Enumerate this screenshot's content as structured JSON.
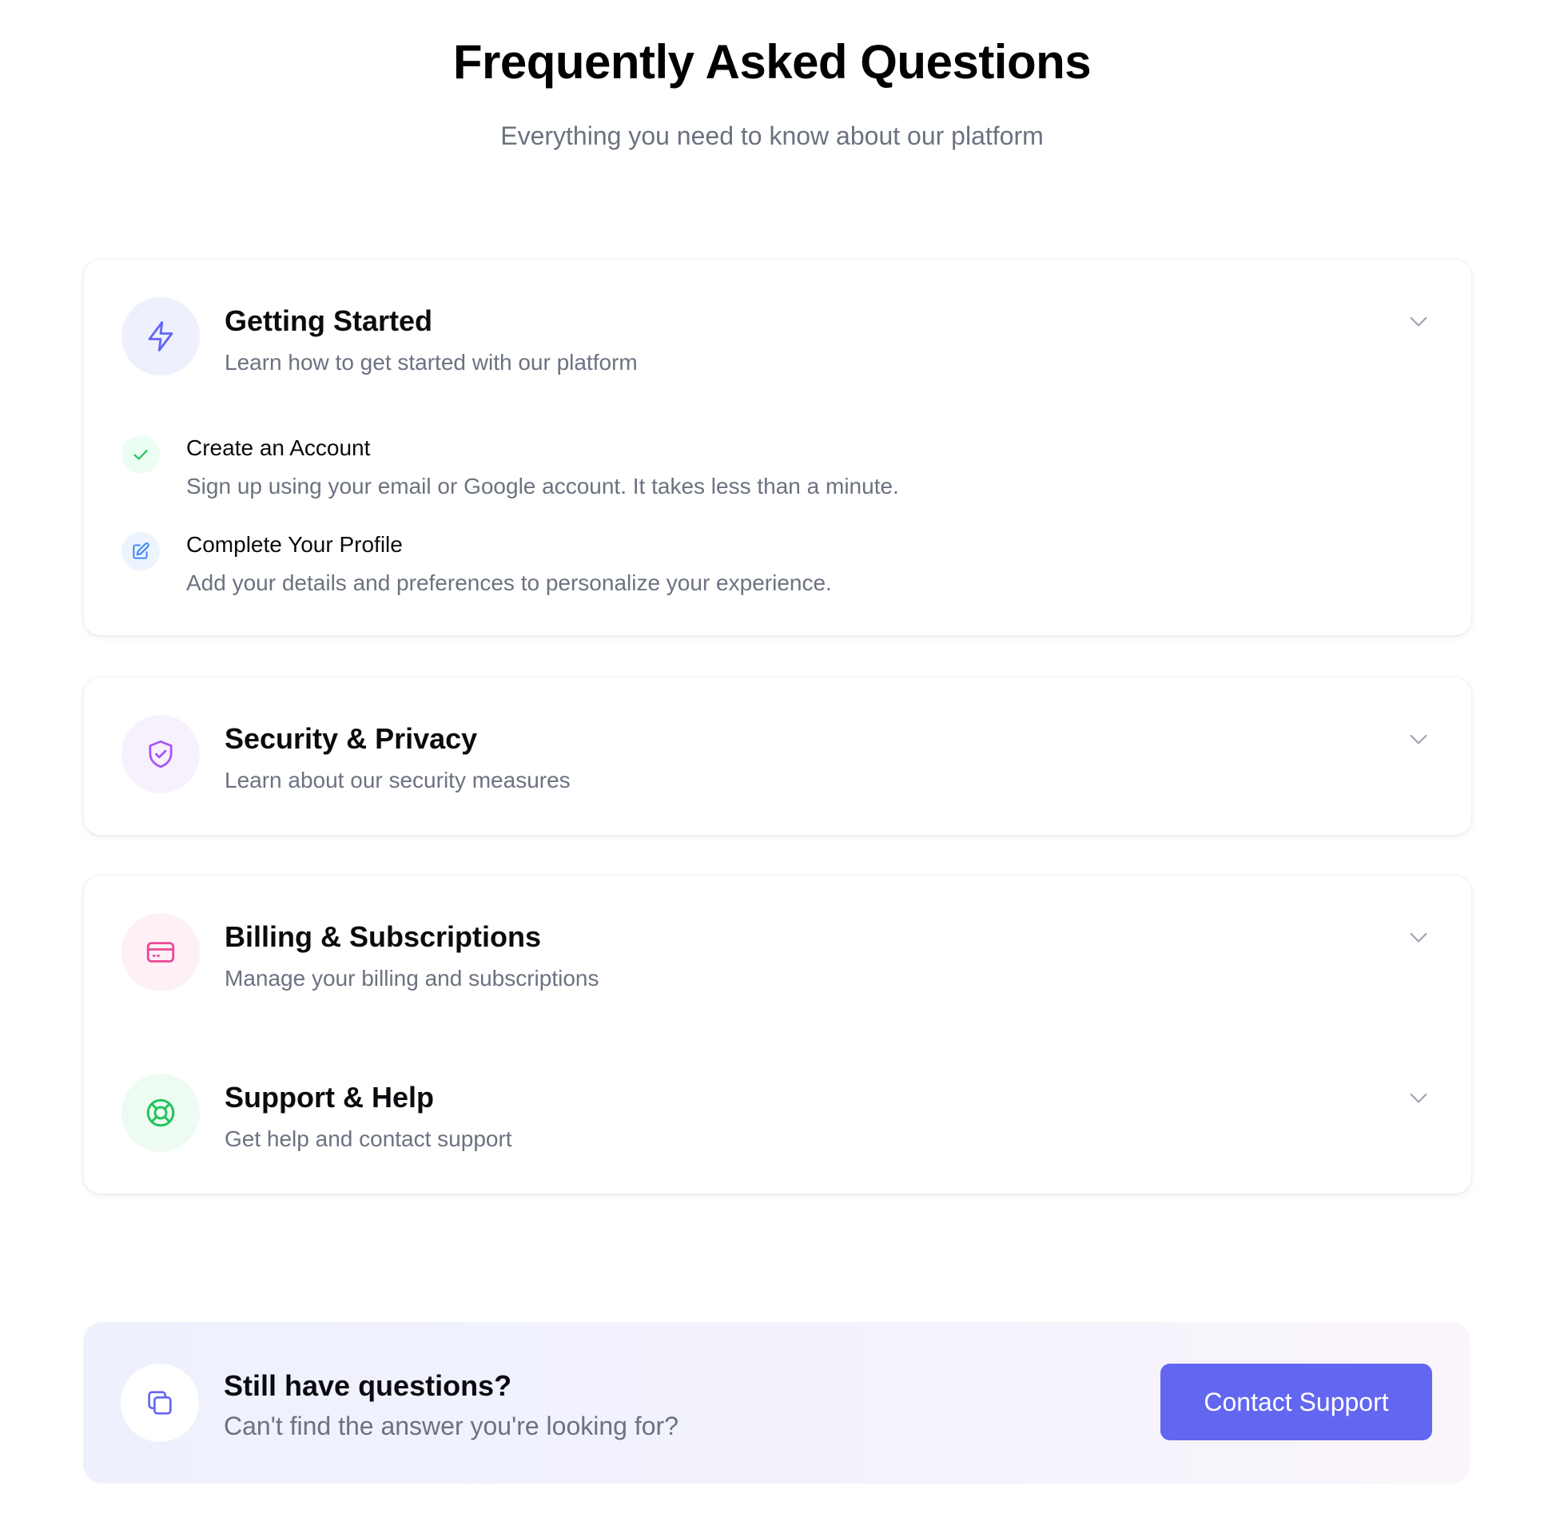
{
  "header": {
    "title": "Frequently Asked Questions",
    "subtitle": "Everything you need to know about our platform"
  },
  "sections": [
    {
      "title": "Getting Started",
      "description": "Learn how to get started with our platform",
      "icon": "lightning-icon",
      "expanded": true,
      "items": [
        {
          "icon": "check-icon",
          "title": "Create an Account",
          "description": "Sign up using your email or Google account. It takes less than a minute."
        },
        {
          "icon": "edit-icon",
          "title": "Complete Your Profile",
          "description": "Add your details and preferences to personalize your experience."
        }
      ]
    },
    {
      "title": "Security & Privacy",
      "description": "Learn about our security measures",
      "icon": "shield-check-icon",
      "expanded": false
    },
    {
      "title": "Billing & Subscriptions",
      "description": "Manage your billing and subscriptions",
      "icon": "credit-card-icon",
      "expanded": false
    },
    {
      "title": "Support & Help",
      "description": "Get help and contact support",
      "icon": "lifebuoy-icon",
      "expanded": false
    }
  ],
  "cta": {
    "title": "Still have questions?",
    "description": "Can't find the answer you're looking for?",
    "button_label": "Contact Support",
    "icon": "copy-icon"
  },
  "colors": {
    "accent": "#6366f1",
    "indigo_icon": "#6366f1",
    "purple_icon": "#a855f7",
    "pink_icon": "#ec4899",
    "green_icon": "#22c55e",
    "blue_icon": "#3b82f6",
    "muted_text": "#6b7280"
  }
}
